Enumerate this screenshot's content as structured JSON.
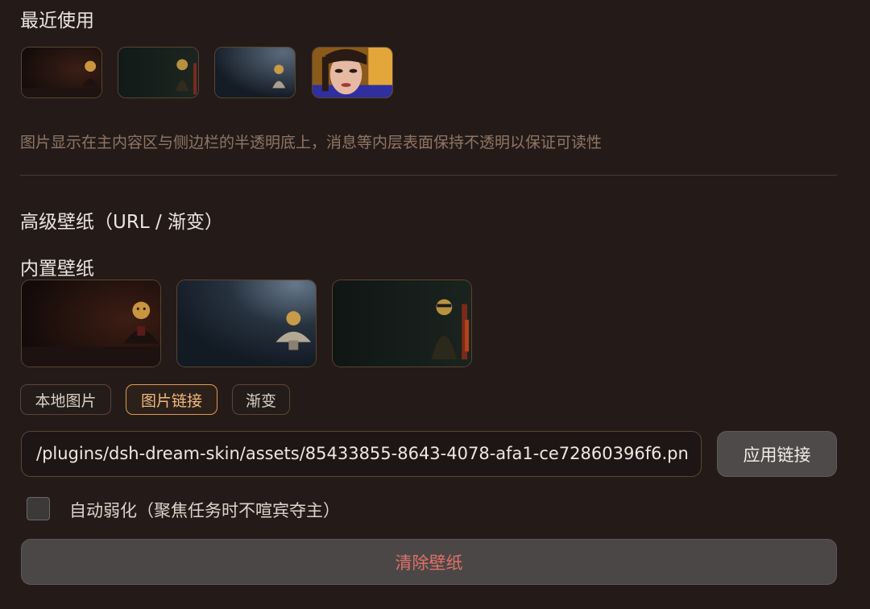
{
  "recent": {
    "title": "最近使用",
    "thumbnails": [
      "wallpaper-thumbnail",
      "wallpaper-thumbnail",
      "wallpaper-thumbnail",
      "portrait-thumbnail"
    ]
  },
  "hint": "图片显示在主内容区与侧边栏的半透明底上，消息等内层表面保持不透明以保证可读性",
  "advanced": {
    "title": "高级壁纸（URL / 渐变）"
  },
  "builtin": {
    "title": "内置壁纸",
    "wallpapers": [
      "wallpaper-thumbnail",
      "wallpaper-thumbnail",
      "wallpaper-thumbnail"
    ]
  },
  "source_tabs": [
    {
      "label": "本地图片",
      "active": false
    },
    {
      "label": "图片链接",
      "active": true
    },
    {
      "label": "渐变",
      "active": false
    }
  ],
  "url_input": {
    "value": "/plugins/dsh-dream-skin/assets/85433855-8643-4078-afa1-ce72860396f6.pn"
  },
  "apply_button": {
    "label": "应用链接"
  },
  "auto_dim": {
    "label": "自动弱化（聚焦任务时不喧宾夺主）",
    "checked": false
  },
  "clear_button": {
    "label": "清除壁纸"
  },
  "colors": {
    "background": "#241b18",
    "accent": "#e09a55",
    "danger": "#e07068",
    "muted_text": "#8f7566"
  }
}
